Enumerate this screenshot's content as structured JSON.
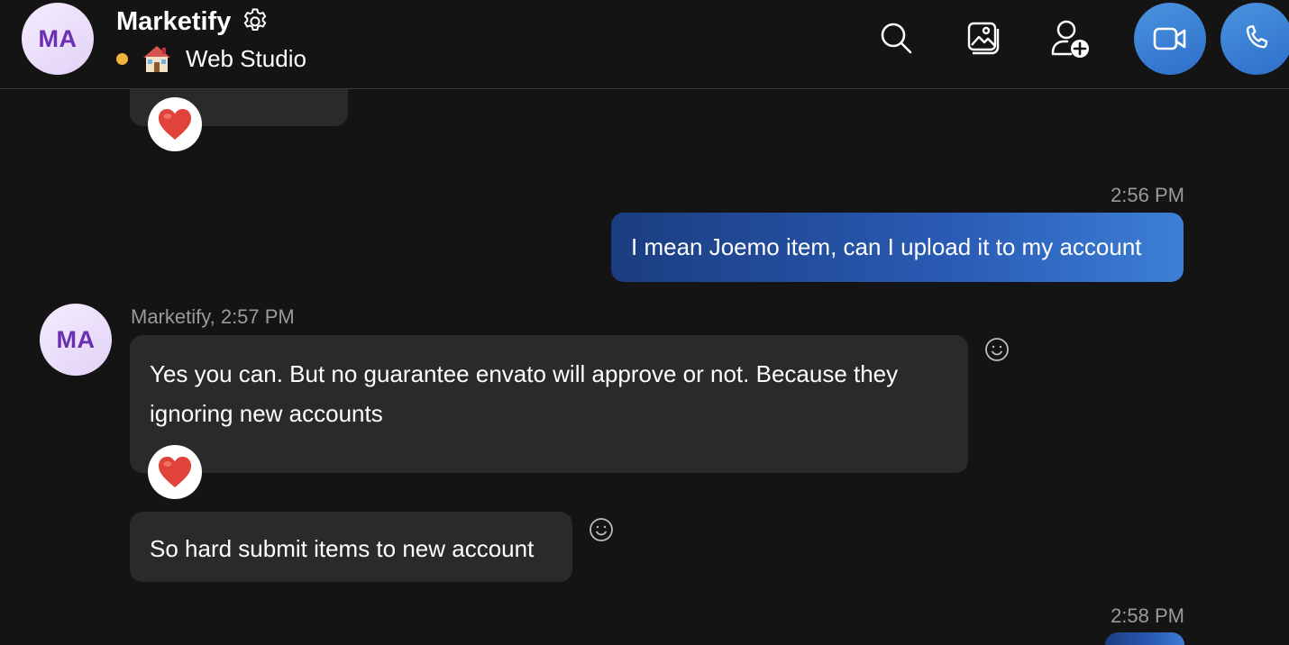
{
  "header": {
    "avatar_initials": "MA",
    "title": "Marketify",
    "subtitle": "Web Studio",
    "status_color": "#f0b43a",
    "icons": [
      "gear-icon",
      "search-icon",
      "image-gallery-icon",
      "add-person-icon",
      "video-camera-icon",
      "phone-icon"
    ]
  },
  "messages": [
    {
      "id": "m0",
      "direction": "incoming",
      "text": "",
      "reaction": "heart"
    },
    {
      "id": "m1",
      "direction": "outgoing",
      "time": "2:56 PM",
      "text": "I mean Joemo item, can I upload it to my account"
    },
    {
      "id": "m2",
      "direction": "incoming",
      "avatar_initials": "MA",
      "sender_line": "Marketify, 2:57 PM",
      "text_line1": "Yes you can. But no guarantee envato will approve or not. Because they",
      "text_line2": "ignoring new accounts",
      "reaction": "heart"
    },
    {
      "id": "m3",
      "direction": "incoming",
      "text": "So hard submit items to new account"
    },
    {
      "id": "m4",
      "direction": "outgoing",
      "time": "2:58 PM",
      "text": ""
    }
  ],
  "colors": {
    "background": "#141414",
    "incoming_bubble": "#2a2a2a",
    "outgoing_start": "#1b3d80",
    "outgoing_end": "#3d7fd6",
    "accent_button": "#3a82d6",
    "avatar_text": "#6b2fb3"
  }
}
